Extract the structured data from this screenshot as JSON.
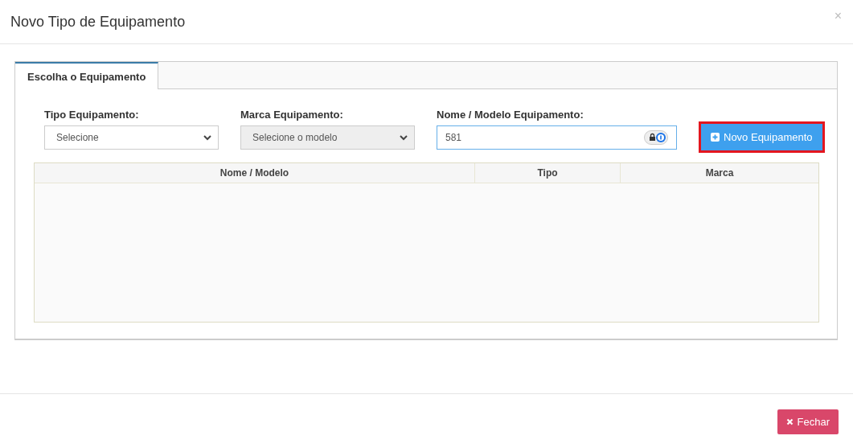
{
  "modal": {
    "title": "Novo Tipo de Equipamento",
    "close": "×"
  },
  "tabs": [
    {
      "label": "Escolha o Equipamento",
      "selected": true
    }
  ],
  "fields": [
    {
      "kind": "select",
      "label": "Tipo Equipamento:",
      "value": "Selecione",
      "disabled": false
    },
    {
      "kind": "select",
      "label": "Marca Equipamento:",
      "value": "Selecione o modelo",
      "disabled": true
    },
    {
      "kind": "text",
      "label": "Nome / Modelo Equipamento:",
      "value": "581",
      "focused": true
    }
  ],
  "new_button": {
    "label": "Novo Equipamento",
    "highlighted": true
  },
  "table": {
    "columns": [
      "Nome / Modelo",
      "Tipo",
      "Marca"
    ]
  },
  "footer": {
    "close_button": "Fechar"
  }
}
